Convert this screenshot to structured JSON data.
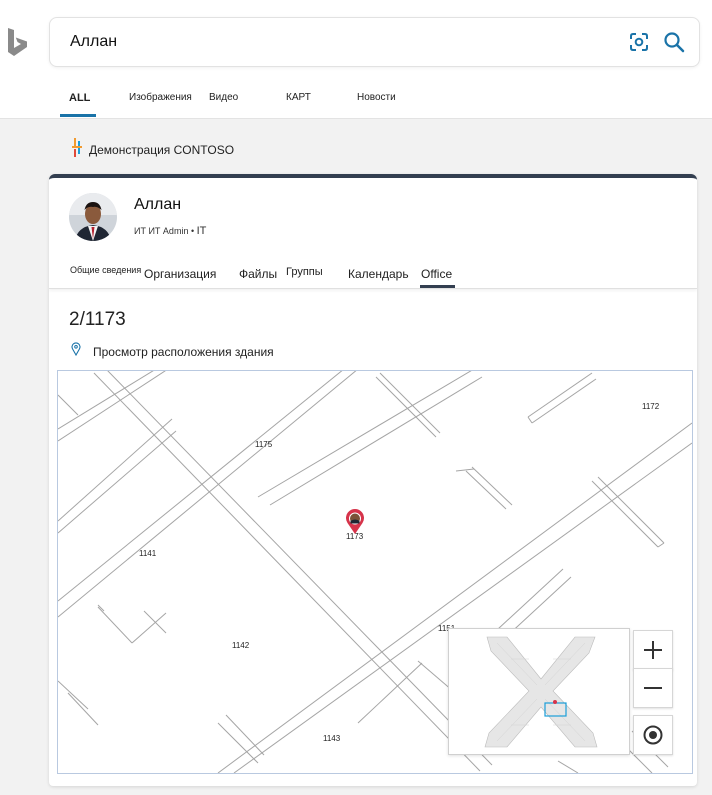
{
  "search": {
    "query": "Аллан"
  },
  "tabs": [
    {
      "label": "ALL",
      "active": true
    },
    {
      "label": "Изображения"
    },
    {
      "label": "Видео"
    },
    {
      "label": "КАРТ"
    },
    {
      "label": "Новости"
    }
  ],
  "brand": {
    "text": "Демонстрация CONTOSO"
  },
  "person": {
    "name": "Аллан",
    "subtitle": "ИТ ИТ Admin •",
    "subtitle_dept": "IT"
  },
  "profile_tabs": [
    {
      "label": "Общие сведения"
    },
    {
      "label": "Организация"
    },
    {
      "label": "Файлы"
    },
    {
      "label": "Группы"
    },
    {
      "label": "Календарь"
    },
    {
      "label": "Office",
      "active": true
    }
  ],
  "office": {
    "number": "2/1173",
    "location_label": "Просмотр расположения здания"
  },
  "map": {
    "rooms": [
      "1175",
      "1172",
      "1173",
      "1141",
      "1142",
      "1143",
      "1151"
    ],
    "controls": {
      "zoom_in": "+",
      "zoom_out": "−"
    }
  },
  "icons": {
    "logo": "bing-logo-icon",
    "visual_search": "visual-search-icon",
    "search": "search-icon",
    "pin": "location-pin-icon",
    "marker": "map-marker-icon",
    "locate": "locate-me-icon"
  },
  "colors": {
    "accent": "#1a73a8",
    "card_top": "#333f50",
    "marker": "#d6334a",
    "minimap_highlight": "#1a9ed8"
  }
}
